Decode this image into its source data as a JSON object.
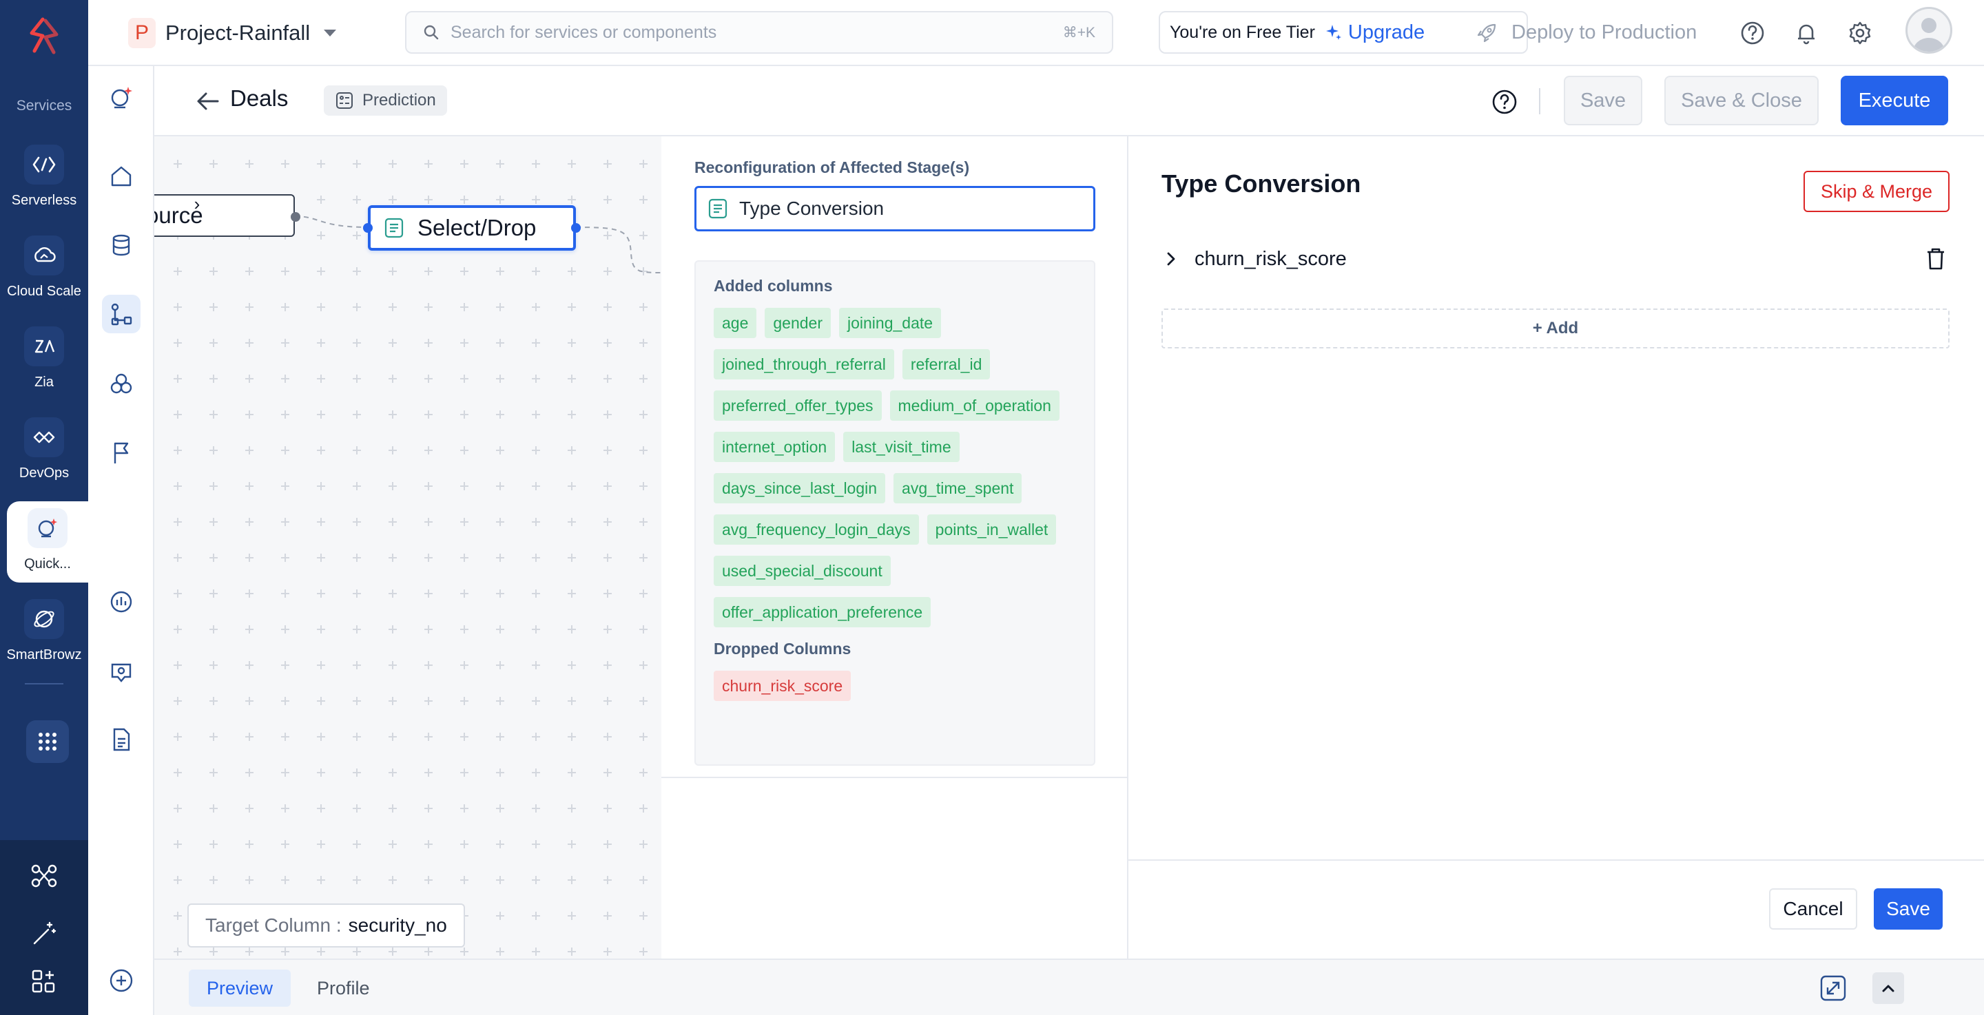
{
  "rail": {
    "section_label": "Services",
    "items": [
      {
        "label": "Serverless",
        "icon": "serverless-icon"
      },
      {
        "label": "Cloud Scale",
        "icon": "cloud-scale-icon"
      },
      {
        "label": "Zia",
        "icon": "zia-icon"
      },
      {
        "label": "DevOps",
        "icon": "devops-icon"
      },
      {
        "label": "Quick...",
        "icon": "quickml-icon",
        "active": true
      },
      {
        "label": "SmartBrowz",
        "icon": "smartbrowz-icon"
      }
    ]
  },
  "topbar": {
    "project_initial": "P",
    "project_name": "Project-Rainfall",
    "search_placeholder": "Search for services or components",
    "search_shortcut": "⌘+K",
    "tier_text": "You're on Free Tier",
    "upgrade_label": "Upgrade",
    "deploy_label": "Deploy to Production"
  },
  "header": {
    "title": "Deals",
    "tag": "Prediction",
    "save_label": "Save",
    "save_close_label": "Save & Close",
    "execute_label": "Execute"
  },
  "canvas": {
    "source_node": "ource",
    "select_node": "Select/Drop",
    "target_label": "Target Column :",
    "target_value": "security_no"
  },
  "middle": {
    "reconfig_label": "Reconfiguration of Affected Stage(s)",
    "stage_value": "Type Conversion",
    "added_label": "Added columns",
    "added_columns": [
      "age",
      "gender",
      "joining_date",
      "joined_through_referral",
      "referral_id",
      "preferred_offer_types",
      "medium_of_operation",
      "internet_option",
      "last_visit_time",
      "days_since_last_login",
      "avg_time_spent",
      "avg_frequency_login_days",
      "points_in_wallet",
      "used_special_discount",
      "offer_application_preference"
    ],
    "dropped_label": "Dropped Columns",
    "dropped_columns": [
      "churn_risk_score"
    ]
  },
  "right": {
    "title": "Type Conversion",
    "skip_merge_label": "Skip & Merge",
    "conversion_column": "churn_risk_score",
    "add_label": "+ Add",
    "cancel_label": "Cancel",
    "save_label": "Save"
  },
  "bottom": {
    "tabs": [
      {
        "label": "Preview",
        "active": true
      },
      {
        "label": "Profile",
        "active": false
      }
    ]
  },
  "colors": {
    "rail_bg": "#1a3568",
    "primary": "#2563eb",
    "added_chip_bg": "#daf2e2",
    "added_chip_text": "#23a35a",
    "dropped_chip_bg": "#fbe1e1",
    "dropped_chip_text": "#d63b3b",
    "danger": "#dc2626"
  }
}
